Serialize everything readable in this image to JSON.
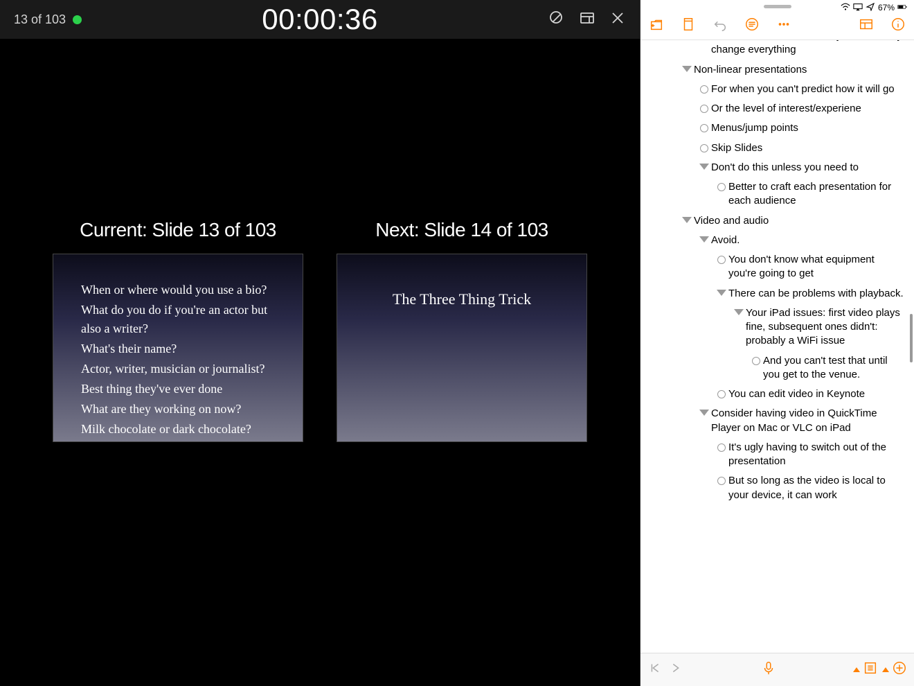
{
  "presenter": {
    "counter": "13 of 103",
    "timer": "00:00:36",
    "current_label": "Current: Slide 13 of 103",
    "next_label": "Next: Slide 14 of 103",
    "current_slide": {
      "lines": [
        "When or where would you use a bio?",
        "What do you do if you're an actor but also a writer?",
        "What's their name?",
        "Actor, writer, musician or journalist?",
        "Best thing they've ever done",
        "What are they working on now?",
        "Milk chocolate or dark chocolate?"
      ]
    },
    "next_slide": {
      "title": "The Three Thing Trick"
    }
  },
  "status": {
    "battery_pct": "67%"
  },
  "outline": {
    "rows": [
      {
        "indent": 2,
        "marker": "circ",
        "text": "Select a master slide, then you can easily change everything",
        "cut_top": true
      },
      {
        "indent": 1,
        "marker": "tri",
        "text": "Non-linear presentations"
      },
      {
        "indent": 2,
        "marker": "circ",
        "text": "For when you can't predict how it will go"
      },
      {
        "indent": 2,
        "marker": "circ",
        "text": "Or the level of interest/experiene"
      },
      {
        "indent": 2,
        "marker": "circ",
        "text": "Menus/jump points"
      },
      {
        "indent": 2,
        "marker": "circ",
        "text": "Skip Slides"
      },
      {
        "indent": 2,
        "marker": "tri",
        "text": "Don't do this unless you need to"
      },
      {
        "indent": 3,
        "marker": "circ",
        "text": "Better to craft each presentation for each audience"
      },
      {
        "indent": 1,
        "marker": "tri",
        "text": "Video and audio"
      },
      {
        "indent": 2,
        "marker": "tri",
        "text": "Avoid."
      },
      {
        "indent": 3,
        "marker": "circ",
        "text": "You don't know what equipment you're going to get"
      },
      {
        "indent": 3,
        "marker": "tri",
        "text": "There can be problems with playback."
      },
      {
        "indent": 4,
        "marker": "tri",
        "text": "Your iPad issues: first video plays fine, subsequent ones didn't: probably a WiFi issue"
      },
      {
        "indent": 5,
        "marker": "circ",
        "text": "And you can't test that until you get to the venue."
      },
      {
        "indent": 3,
        "marker": "circ",
        "text": "You can edit video in Keynote"
      },
      {
        "indent": 2,
        "marker": "tri",
        "text": "Consider having video in QuickTime Player on Mac or VLC on iPad"
      },
      {
        "indent": 3,
        "marker": "circ",
        "text": "It's ugly having to switch out of the presentation"
      },
      {
        "indent": 3,
        "marker": "circ",
        "text": "But so long as the video is local to your device, it can work"
      }
    ]
  }
}
